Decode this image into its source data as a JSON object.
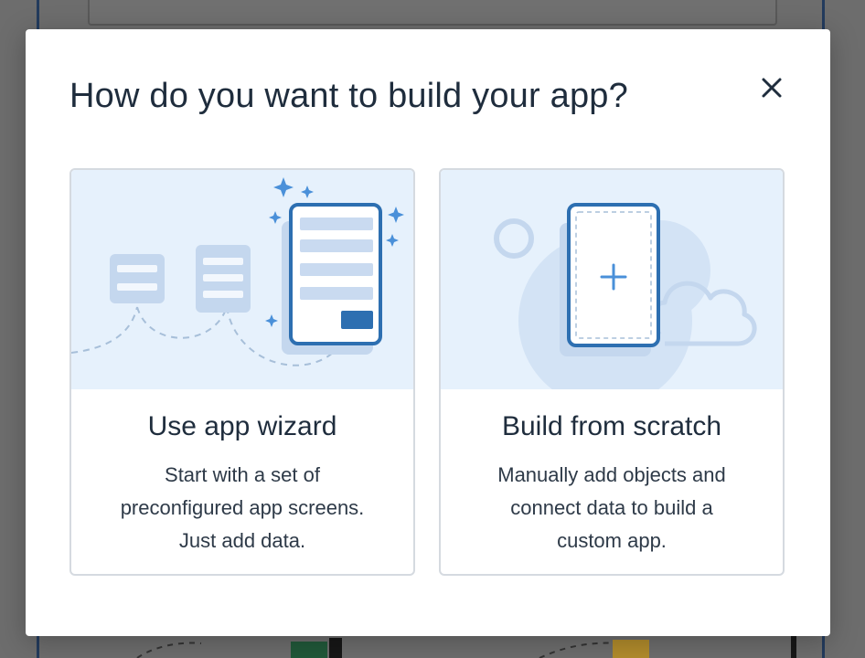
{
  "modal": {
    "title": "How do you want to build your app?",
    "close_icon": "close-icon"
  },
  "options": [
    {
      "title": "Use app wizard",
      "description_lines": [
        "Start with a set of",
        "preconfigured app screens.",
        "Just add data."
      ],
      "illustration": "app-wizard-illustration"
    },
    {
      "title": "Build from scratch",
      "description_lines": [
        "Manually add objects and",
        "connect data to build a",
        "custom app."
      ],
      "illustration": "build-from-scratch-illustration"
    }
  ],
  "colors": {
    "illustration_bg": "#e6f1fc",
    "accent_blue": "#2d6fb1",
    "light_blue": "#c9daf0",
    "sparkle_blue": "#4a90d9",
    "title_text": "#1f2d3d",
    "card_border": "#d5dae0"
  }
}
